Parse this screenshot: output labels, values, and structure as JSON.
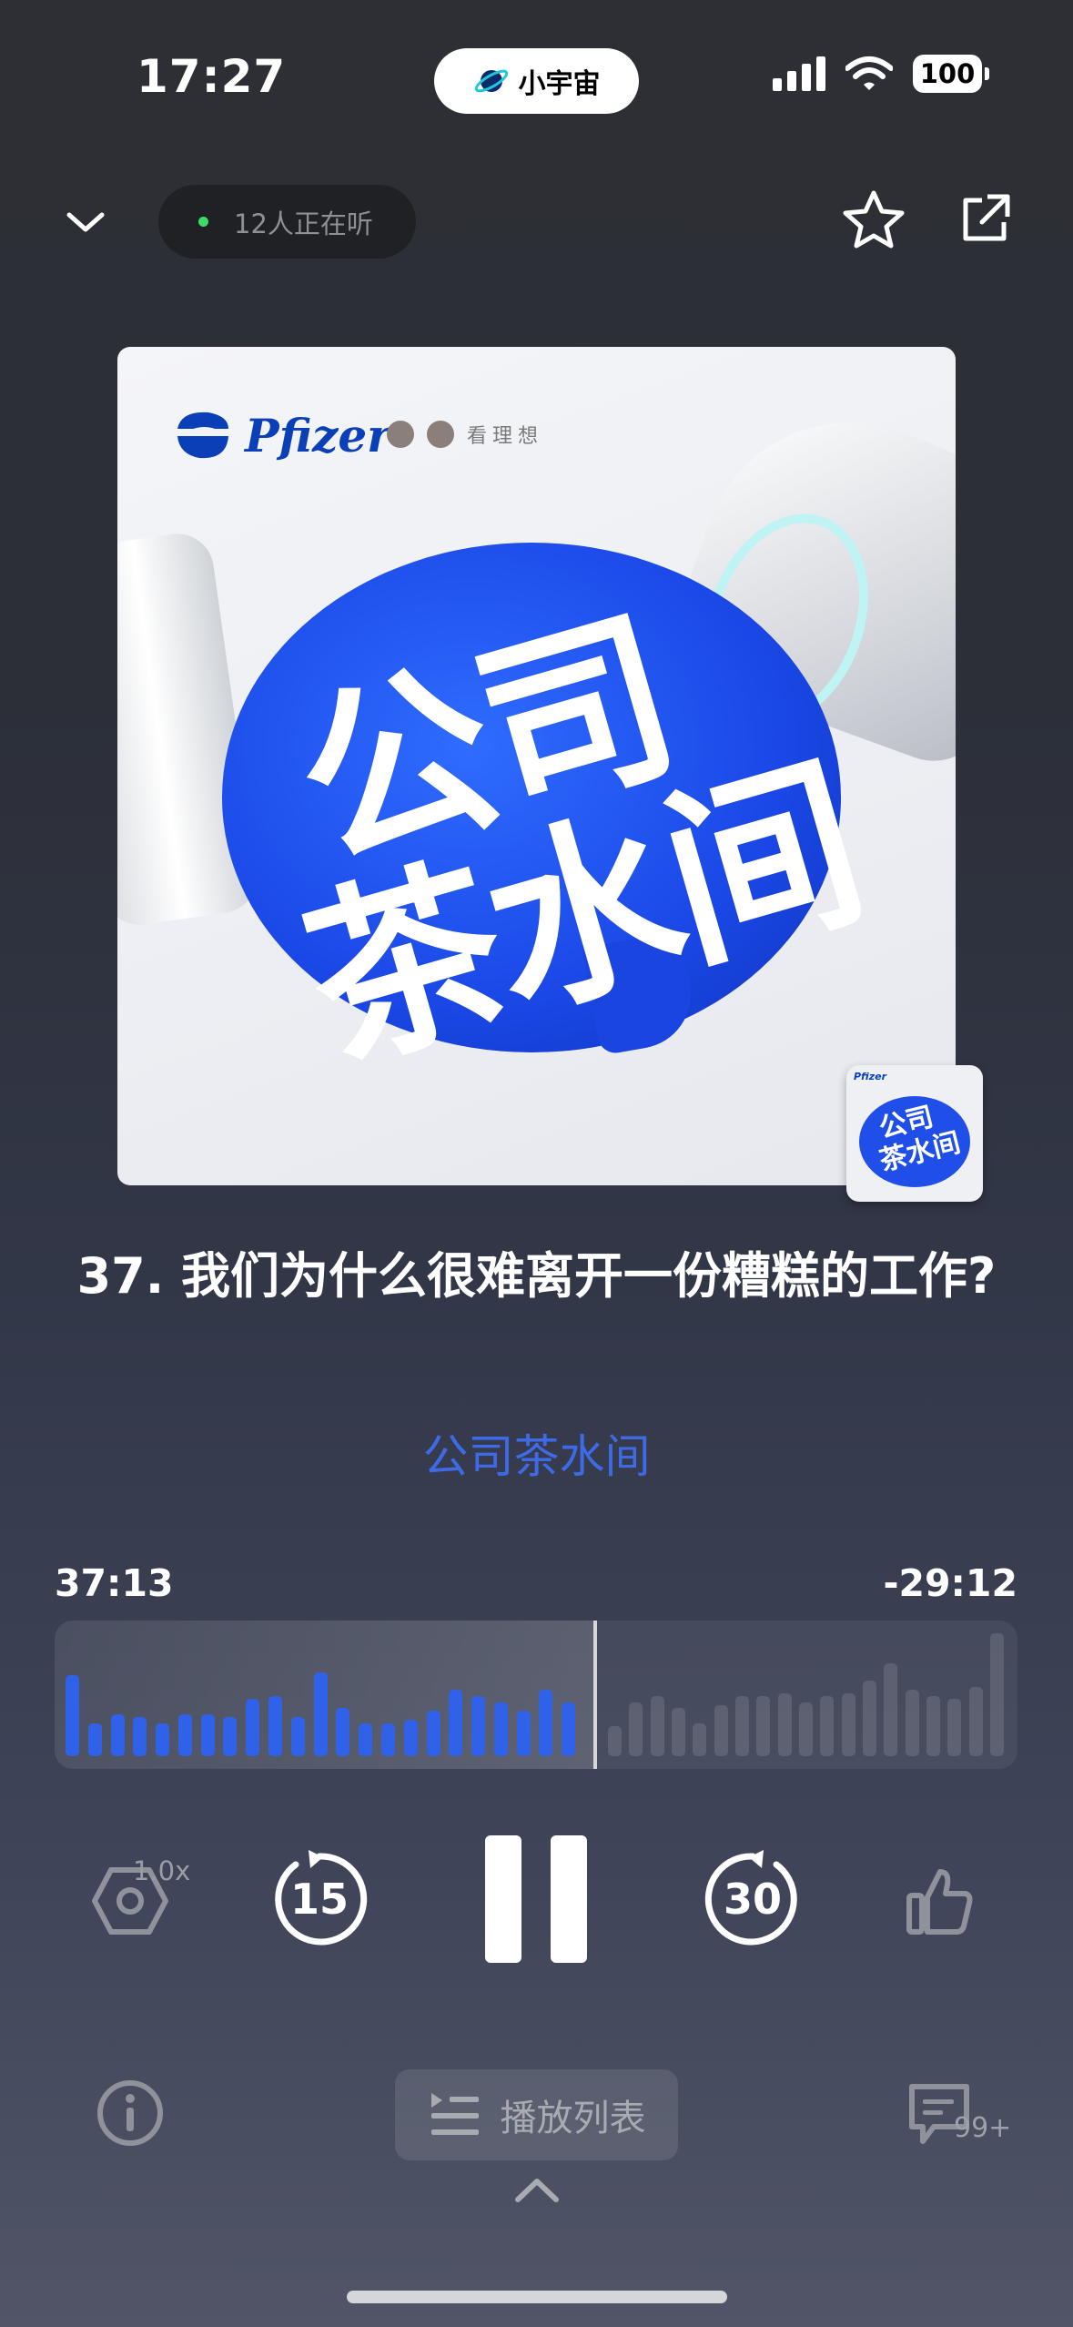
{
  "status_bar": {
    "time": "17:27",
    "island_app": "小宇宙",
    "battery": "100"
  },
  "header": {
    "listeners": "12人正在听",
    "icons": [
      "chevron-down-icon",
      "star-icon",
      "share-icon"
    ]
  },
  "cover": {
    "brand": "Pfizer",
    "partner": "看理想",
    "title_line1": "公司",
    "title_line2": "茶水间"
  },
  "episode": {
    "title": "37. 我们为什么很难离开一份糟糕的工作?",
    "podcast": "公司茶水间"
  },
  "player": {
    "elapsed": "37:13",
    "remaining": "-29:12",
    "progress_fraction": 0.56,
    "speed": "1.0x",
    "skip_back": "15",
    "skip_forward": "30",
    "waveform_played": [
      54,
      22,
      28,
      26,
      22,
      28,
      28,
      26,
      38,
      40,
      26,
      56,
      32,
      22,
      22,
      24,
      30,
      44,
      40,
      36,
      30,
      44,
      36
    ],
    "waveform_remaining": [
      20,
      36,
      40,
      32,
      22,
      34,
      40,
      40,
      42,
      36,
      40,
      42,
      50,
      62,
      44,
      40,
      38,
      46,
      82
    ]
  },
  "bottom": {
    "playlist_label": "播放列表",
    "comment_count": "99+"
  },
  "colors": {
    "accent_blue": "#3e6ae6",
    "wave_blue": "#2f62e8",
    "listening_green": "#3ddc67"
  }
}
